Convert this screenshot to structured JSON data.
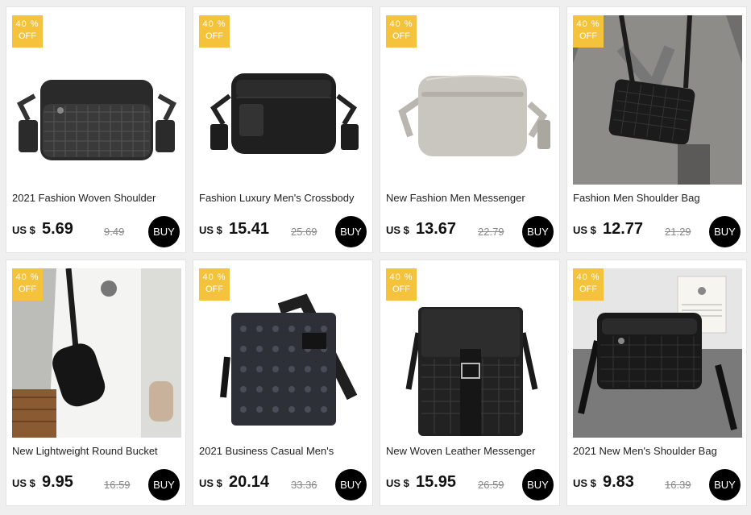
{
  "currency_label": "US $",
  "buy_label": "BUY",
  "badge": {
    "percent": "40 %",
    "off": "OFF"
  },
  "products": [
    {
      "title": "2021 Fashion Woven Shoulder",
      "price": "5.69",
      "old_price": "9.49"
    },
    {
      "title": "Fashion Luxury Men's Crossbody",
      "price": "15.41",
      "old_price": "25.69"
    },
    {
      "title": "New Fashion Men Messenger",
      "price": "13.67",
      "old_price": "22.79"
    },
    {
      "title": "Fashion Men Shoulder Bag",
      "price": "12.77",
      "old_price": "21.29"
    },
    {
      "title": "New Lightweight Round Bucket",
      "price": "9.95",
      "old_price": "16.59"
    },
    {
      "title": "2021 Business Casual Men's",
      "price": "20.14",
      "old_price": "33.36"
    },
    {
      "title": "New Woven Leather Messenger",
      "price": "15.95",
      "old_price": "26.59"
    },
    {
      "title": "2021 New Men's Shoulder Bag",
      "price": "9.83",
      "old_price": "16.39"
    }
  ]
}
